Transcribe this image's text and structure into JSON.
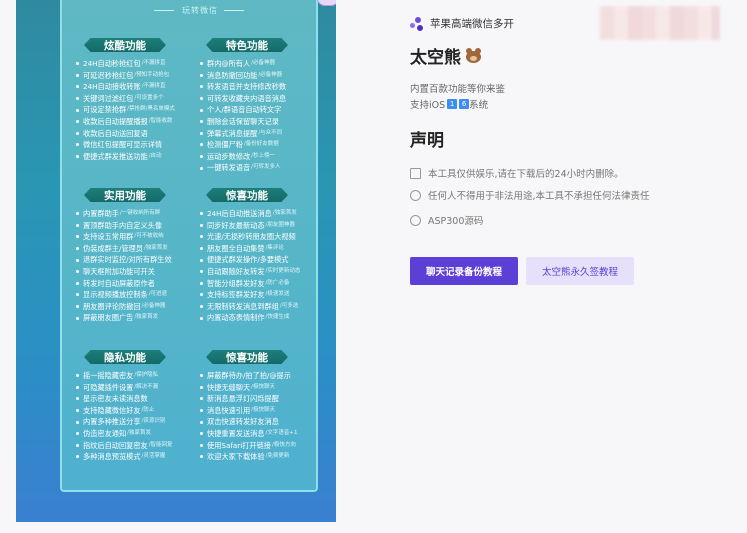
{
  "poster": {
    "top_label": "玩转微信",
    "sections": [
      {
        "title": "炫酷功能",
        "items": [
          {
            "text": "24H自动秒抢红包",
            "tag": "/不漏拼直"
          },
          {
            "text": "可延迟秒抢红包",
            "tag": "/预知手动抢包"
          },
          {
            "text": "24H自动接收转账",
            "tag": "/不漏拼直"
          },
          {
            "text": "关键词过滤红包",
            "tag": "/可设置多个"
          },
          {
            "text": "可设定禁抢群",
            "tag": "/禁抢群/黑名单模式"
          },
          {
            "text": "收款后自动提醒播报",
            "tag": "/智能收款"
          },
          {
            "text": "收款后自动送回复语",
            "tag": ""
          },
          {
            "text": "微信红包提醒可显示详情",
            "tag": ""
          },
          {
            "text": "便捷式群发推送功能",
            "tag": "/自动"
          }
        ]
      },
      {
        "title": "特色功能",
        "items": [
          {
            "text": "群内@所有人",
            "tag": "/必备神器"
          },
          {
            "text": "消息防撤回功能",
            "tag": "/必备神器"
          },
          {
            "text": "转发语音并支持修改秒数",
            "tag": ""
          },
          {
            "text": "可转发收藏夹内语音消息",
            "tag": ""
          },
          {
            "text": "个人/群语音自动转文字",
            "tag": ""
          },
          {
            "text": "删除会话保留聊天记录",
            "tag": ""
          },
          {
            "text": "弹幕式消息提醒",
            "tag": "/与众不同"
          },
          {
            "text": "检测僵尸粉",
            "tag": "/备份好友数据"
          },
          {
            "text": "运动步数修改",
            "tag": "/秒上榜一"
          },
          {
            "text": "一键转发语音",
            "tag": "/可转发多人"
          }
        ]
      },
      {
        "title": "实用功能",
        "items": [
          {
            "text": "内置群助手",
            "tag": "/一键收纳所有群"
          },
          {
            "text": "置顶群助手内自定义头像",
            "tag": ""
          },
          {
            "text": "支持设五常用群",
            "tag": "/可不被收纳"
          },
          {
            "text": "伪装成群主/管理员",
            "tag": "/独家首发"
          },
          {
            "text": "退群实时监控/对所有群生效",
            "tag": ""
          },
          {
            "text": "聊天框附加功能可开关",
            "tag": ""
          },
          {
            "text": "转发时自动屏蔽原作者",
            "tag": ""
          },
          {
            "text": "显示视频播放控制条",
            "tag": "/可进退"
          },
          {
            "text": "朋友圈评论防撤回",
            "tag": "/必备神器"
          },
          {
            "text": "屏蔽朋友圈广告",
            "tag": "/独家首发"
          }
        ]
      },
      {
        "title": "惊喜功能",
        "items": [
          {
            "text": "24H后自动推送消息",
            "tag": "/独家首发"
          },
          {
            "text": "同步好友最新动态",
            "tag": "/朋友圈神器"
          },
          {
            "text": "光速/无损秒转朋友圈大视频",
            "tag": ""
          },
          {
            "text": "朋友圈全自动集赞",
            "tag": "/集评论"
          },
          {
            "text": "便捷式群发操作/多要模式",
            "tag": ""
          },
          {
            "text": "自动跟随好友转发",
            "tag": "/实时更新动态"
          },
          {
            "text": "智能分组群发好友",
            "tag": "/防广必备"
          },
          {
            "text": "支持标签群发好友",
            "tag": "/极速发送"
          },
          {
            "text": "无限制转发消息到群组",
            "tag": "/可多选"
          },
          {
            "text": "内置动态表情制作",
            "tag": "/快捷生成"
          }
        ]
      },
      {
        "title": "隐私功能",
        "items": [
          {
            "text": "摇一摇隐藏密友",
            "tag": "/保护隐私"
          },
          {
            "text": "可隐藏插件设置",
            "tag": "/解决不漏"
          },
          {
            "text": "星示密友未读消息数",
            "tag": ""
          },
          {
            "text": "支持隐藏微信好友",
            "tag": "/防止"
          },
          {
            "text": "内置多种推送分享",
            "tag": "/资源识别"
          },
          {
            "text": "伪造密友通知",
            "tag": "/独家首发"
          },
          {
            "text": "指纹后自动回复密友",
            "tag": "/智能回复"
          },
          {
            "text": "多种消息预览模式",
            "tag": "/灵活掌握"
          }
        ]
      },
      {
        "title": "惊喜功能",
        "items": [
          {
            "text": "屏蔽群待办/拍了拍/@提示",
            "tag": ""
          },
          {
            "text": "快捷无缝聊天",
            "tag": "/极快聊天"
          },
          {
            "text": "新消息悬浮灯闪烁提醒",
            "tag": ""
          },
          {
            "text": "消息快速引用",
            "tag": "/极快聊天"
          },
          {
            "text": "双击快速转发好友消息",
            "tag": ""
          },
          {
            "text": "快捷重置发送消息",
            "tag": "/文字语音+1"
          },
          {
            "text": "使用Safari打开链接",
            "tag": "/极快方向"
          },
          {
            "text": "欢迎大家下载体验",
            "tag": "/免费更新"
          }
        ]
      }
    ]
  },
  "app": {
    "name": "苹果高端微信多开",
    "title": "太空熊",
    "title_emoji": "bear-face-icon",
    "subtitle": "内置百款功能等你来鉴",
    "support_prefix": "支持iOS",
    "support_badges": [
      "1",
      "6"
    ],
    "support_suffix": "系统",
    "statement_heading": "声明",
    "statements": [
      {
        "icon": "calendar-icon",
        "text": "本工具仅供娱乐,请在下载后的24小时内删除。"
      },
      {
        "icon": "warning-icon",
        "text": "任何人不得用于非法用途,本工具不承担任何法律责任"
      },
      {
        "icon": "settings-icon",
        "text": "ASP300源码"
      }
    ],
    "buttons": {
      "primary": "聊天记录备份教程",
      "secondary": "太空熊永久签教程"
    }
  },
  "colors": {
    "accent": "#5b3fd6",
    "accent_light": "#e6e0fa",
    "poster_teal": "#56b6c8"
  }
}
